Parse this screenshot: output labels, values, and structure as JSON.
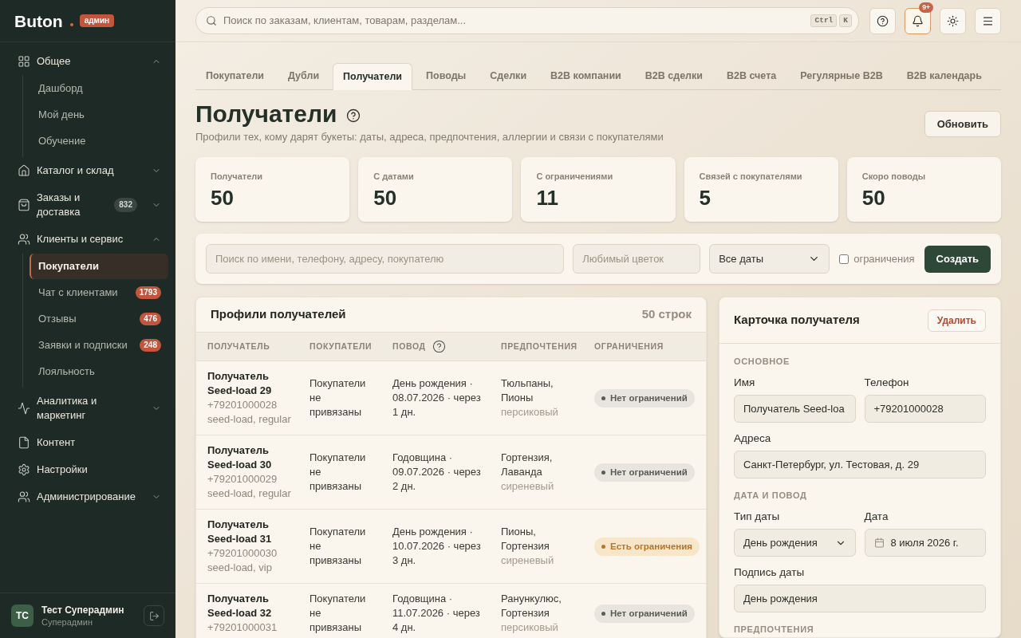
{
  "sidebar": {
    "logo": "Buton",
    "role_badge": "админ",
    "groups": [
      {
        "label": "Общее",
        "expanded": true,
        "children": [
          {
            "label": "Дашборд",
            "selected": false
          },
          {
            "label": "Мой день",
            "selected": false
          },
          {
            "label": "Обучение",
            "selected": false
          }
        ]
      },
      {
        "label": "Каталог и склад",
        "expanded": false
      },
      {
        "label": "Заказы и доставка",
        "badge": "832",
        "expanded": false
      },
      {
        "label": "Клиенты и сервис",
        "expanded": true,
        "children": [
          {
            "label": "Покупатели",
            "selected": true
          },
          {
            "label": "Чат с клиентами",
            "badge": "1793",
            "selected": false
          },
          {
            "label": "Отзывы",
            "badge": "476",
            "selected": false
          },
          {
            "label": "Заявки и подписки",
            "badge": "248",
            "selected": false
          },
          {
            "label": "Лояльность",
            "selected": false
          }
        ]
      },
      {
        "label": "Аналитика и маркетинг",
        "expanded": false
      },
      {
        "label": "Контент"
      },
      {
        "label": "Настройки"
      },
      {
        "label": "Администрирование",
        "expanded": false
      }
    ],
    "user": {
      "initials": "ТС",
      "name": "Тест Суперадмин",
      "role": "Суперадмин"
    }
  },
  "topbar": {
    "search": {
      "placeholder": "Поиск по заказам, клиентам, товарам, разделам...",
      "shortcut": [
        "Ctrl",
        "K"
      ]
    },
    "buttons": [
      {
        "kind": "help",
        "highlighted": false
      },
      {
        "kind": "notifications",
        "badge": "9+",
        "highlighted": true
      },
      {
        "kind": "theme",
        "highlighted": false
      },
      {
        "kind": "menu",
        "highlighted": false
      }
    ]
  },
  "tabs": [
    {
      "label": "Покупатели",
      "selected": false
    },
    {
      "label": "Дубли",
      "selected": false
    },
    {
      "label": "Получатели",
      "selected": true
    },
    {
      "label": "Поводы",
      "selected": false
    },
    {
      "label": "Сделки",
      "selected": false
    },
    {
      "label": "B2B компании",
      "selected": false
    },
    {
      "label": "B2B сделки",
      "selected": false
    },
    {
      "label": "B2B счета",
      "selected": false
    },
    {
      "label": "Регулярные B2B",
      "selected": false
    },
    {
      "label": "B2B календарь",
      "selected": false
    }
  ],
  "page": {
    "title": "Получатели",
    "subtitle": "Профили тех, кому дарят букеты: даты, адреса, предпочтения, аллергии и связи с покупателями",
    "refresh_button": "Обновить"
  },
  "stats": [
    {
      "label": "Получатели",
      "value": "50"
    },
    {
      "label": "С датами",
      "value": "50"
    },
    {
      "label": "С ограничениями",
      "value": "11"
    },
    {
      "label": "Связей с покупателями",
      "value": "5"
    },
    {
      "label": "Скоро поводы",
      "value": "50"
    }
  ],
  "filters": {
    "search": {
      "placeholder": "Поиск по имени, телефону, адресу, покупателю"
    },
    "flower": {
      "placeholder": "Любимый цветок"
    },
    "date_select": {
      "value": "Все даты"
    },
    "restrictions_checkbox": {
      "label": "ограничения",
      "checked": false
    },
    "create_button": "Создать"
  },
  "table": {
    "title": "Профили получателей",
    "count": "50 строк",
    "columns": [
      {
        "label": "ПОЛУЧАТЕЛЬ",
        "help": false
      },
      {
        "label": "ПОКУПАТЕЛИ",
        "help": false
      },
      {
        "label": "ПОВОД",
        "help": true
      },
      {
        "label": "ПРЕДПОЧТЕНИЯ",
        "help": false
      },
      {
        "label": "ОГРАНИЧЕНИЯ",
        "help": false
      }
    ],
    "rows": [
      {
        "name": "Получатель Seed-load 29",
        "phone": "+79201000028",
        "tags": "seed-load, regular",
        "buyers": "Покупатели не привязаны",
        "occasion": "День рождения · 08.07.2026 · через 1 дн.",
        "flowers": "Тюльпаны, Пионы",
        "color_preference": "персиковый",
        "restriction": {
          "label": "Нет ограничений",
          "restricted": false
        }
      },
      {
        "name": "Получатель Seed-load 30",
        "phone": "+79201000029",
        "tags": "seed-load, regular",
        "buyers": "Покупатели не привязаны",
        "occasion": "Годовщина · 09.07.2026 · через 2 дн.",
        "flowers": "Гортензия, Лаванда",
        "color_preference": "сиреневый",
        "restriction": {
          "label": "Нет ограничений",
          "restricted": false
        }
      },
      {
        "name": "Получатель Seed-load 31",
        "phone": "+79201000030",
        "tags": "seed-load, vip",
        "buyers": "Покупатели не привязаны",
        "occasion": "День рождения · 10.07.2026 · через 3 дн.",
        "flowers": "Пионы, Гортензия",
        "color_preference": "сиреневый",
        "restriction": {
          "label": "Есть ограничения",
          "restricted": true
        }
      },
      {
        "name": "Получатель Seed-load 32",
        "phone": "+79201000031",
        "buyers": "Покупатели не привязаны",
        "occasion": "Годовщина · 11.07.2026 · через 4 дн.",
        "flowers": "Ранункулюс, Гортензия",
        "color_preference": "персиковый",
        "restriction": {
          "label": "Нет ограничений",
          "restricted": false
        }
      }
    ]
  },
  "card": {
    "title": "Карточка получателя",
    "delete_button": "Удалить",
    "sections": [
      {
        "title": "ОСНОВНОЕ",
        "rows": [
          [
            {
              "kind": "text",
              "label": "Имя",
              "value": "Получатель Seed-loa"
            },
            {
              "kind": "text",
              "label": "Телефон",
              "value": "+79201000028"
            }
          ],
          [
            {
              "kind": "text",
              "label": "Адреса",
              "value": "Санкт-Петербург, ул. Тестовая, д. 29"
            }
          ]
        ]
      },
      {
        "title": "ДАТА И ПОВОД",
        "rows": [
          [
            {
              "kind": "select",
              "label": "Тип даты",
              "value": "День рождения"
            },
            {
              "kind": "date",
              "label": "Дата",
              "value": "8 июля 2026 г."
            }
          ],
          [
            {
              "kind": "text",
              "label": "Подпись даты",
              "value": "День рождения"
            }
          ]
        ]
      },
      {
        "title": "ПРЕДПОЧТЕНИЯ"
      }
    ]
  }
}
